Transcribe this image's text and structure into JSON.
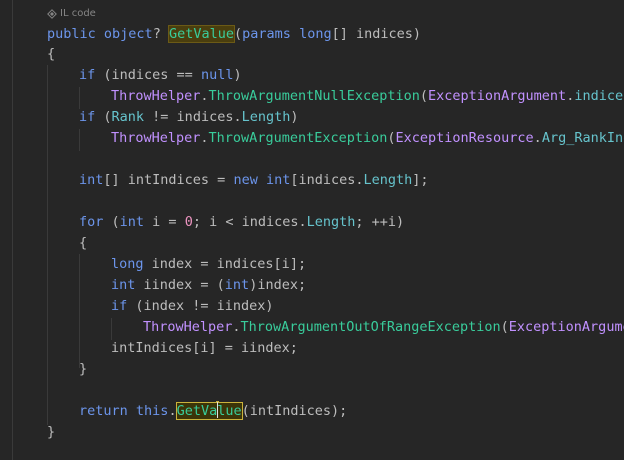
{
  "inlay_hint": {
    "label": "IL code",
    "icon": "il-code-icon"
  },
  "colors": {
    "background": "#262626",
    "keyword": "#6c95eb",
    "method": "#39cc9b",
    "type": "#c191ff",
    "property": "#66c3cc",
    "number": "#ed94c0",
    "plain": "#bdbdbd"
  },
  "code": {
    "l1": {
      "kw_public": "public",
      "kw_object": "object",
      "q": "? ",
      "method": "GetValue",
      "p_open": "(",
      "kw_params": "params",
      "kw_long": "long",
      "rest": "[] indices)"
    },
    "l2": {
      "brace": "{"
    },
    "l3": {
      "kw_if": "if",
      "mid": " (indices == ",
      "kw_null": "null",
      "close": ")"
    },
    "l4": {
      "type": "ThrowHelper",
      "dot": ".",
      "method": "ThrowArgumentNullException",
      "paren": "(",
      "type2": "ExceptionArgument",
      "dot2": ".",
      "prop": "indices"
    },
    "l5": {
      "kw_if": "if",
      "open": " (",
      "prop": "Rank",
      "mid": " != indices.",
      "prop2": "Length",
      "close": ")"
    },
    "l6": {
      "type": "ThrowHelper",
      "dot": ".",
      "method": "ThrowArgumentException",
      "paren": "(",
      "type2": "ExceptionResource",
      "dot2": ".",
      "prop": "Arg_RankIndi"
    },
    "l7": {
      "kw_int": "int",
      "mid": "[] intIndices = ",
      "kw_new": "new",
      "kw_int2": "int",
      "rest": "[indices.",
      "prop": "Length",
      "end": "];"
    },
    "l8": {
      "kw_for": "for",
      "open": " (",
      "kw_int": "int",
      "a": " i = ",
      "num": "0",
      "b": "; i < indices.",
      "prop": "Length",
      "c": "; ++i)"
    },
    "l9": {
      "brace": "{"
    },
    "l10": {
      "kw_long": "long",
      "rest": " index = indices[i];"
    },
    "l11": {
      "kw_int": "int",
      "a": " iindex = (",
      "kw_int2": "int",
      "b": ")index;"
    },
    "l12": {
      "kw_if": "if",
      "rest": " (index != iindex)"
    },
    "l13": {
      "type": "ThrowHelper",
      "dot": ".",
      "method": "ThrowArgumentOutOfRangeException",
      "paren": "(",
      "type2": "ExceptionArgumen"
    },
    "l14": {
      "rest": "intIndices[i] = iindex;"
    },
    "l15": {
      "brace": "}"
    },
    "l16": {
      "kw_return": "return",
      "kw_this": "this",
      "dot": ".",
      "m1": "GetVa",
      "m2": "lue",
      "rest": "(intIndices);"
    },
    "l17": {
      "brace": "}"
    }
  }
}
